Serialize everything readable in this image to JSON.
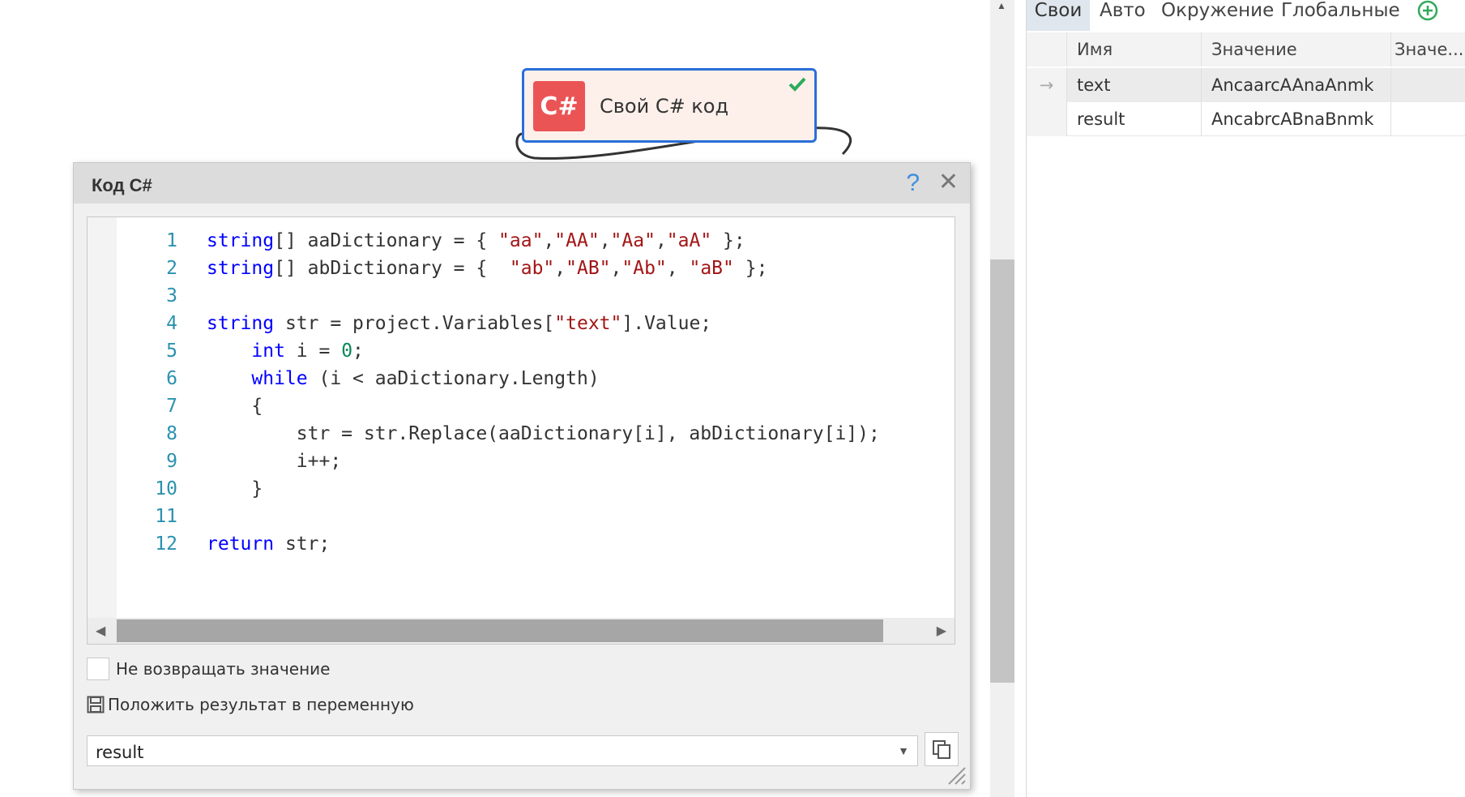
{
  "node": {
    "icon_text": "C#",
    "title": "Свой C# код",
    "status_icon": "check-icon"
  },
  "dialog": {
    "title": "Код C#",
    "help_label": "?",
    "close_label": "✕",
    "code_lines": [
      {
        "n": "1",
        "tokens": [
          [
            "kw",
            "string"
          ],
          [
            "t",
            "[] aaDictionary = { "
          ],
          [
            "str",
            "\"aa\""
          ],
          [
            "t",
            ","
          ],
          [
            "str",
            "\"AA\""
          ],
          [
            "t",
            ","
          ],
          [
            "str",
            "\"Aa\""
          ],
          [
            "t",
            ","
          ],
          [
            "str",
            "\"aA\""
          ],
          [
            "t",
            " };"
          ]
        ]
      },
      {
        "n": "2",
        "tokens": [
          [
            "kw",
            "string"
          ],
          [
            "t",
            "[] abDictionary = {  "
          ],
          [
            "str",
            "\"ab\""
          ],
          [
            "t",
            ","
          ],
          [
            "str",
            "\"AB\""
          ],
          [
            "t",
            ","
          ],
          [
            "str",
            "\"Ab\""
          ],
          [
            "t",
            ", "
          ],
          [
            "str",
            "\"aB\""
          ],
          [
            "t",
            " };"
          ]
        ]
      },
      {
        "n": "3",
        "tokens": []
      },
      {
        "n": "4",
        "tokens": [
          [
            "kw",
            "string"
          ],
          [
            "t",
            " str = project.Variables["
          ],
          [
            "str",
            "\"text\""
          ],
          [
            "t",
            "].Value;"
          ]
        ]
      },
      {
        "n": "5",
        "tokens": [
          [
            "t",
            "    "
          ],
          [
            "kw",
            "int"
          ],
          [
            "t",
            " i = "
          ],
          [
            "num",
            "0"
          ],
          [
            "t",
            ";"
          ]
        ]
      },
      {
        "n": "6",
        "tokens": [
          [
            "t",
            "    "
          ],
          [
            "kw",
            "while"
          ],
          [
            "t",
            " (i < aaDictionary.Length)"
          ]
        ]
      },
      {
        "n": "7",
        "tokens": [
          [
            "t",
            "    {"
          ]
        ]
      },
      {
        "n": "8",
        "tokens": [
          [
            "t",
            "        str = str.Replace(aaDictionary[i], abDictionary[i]);"
          ]
        ]
      },
      {
        "n": "9",
        "tokens": [
          [
            "t",
            "        i++;"
          ]
        ]
      },
      {
        "n": "10",
        "tokens": [
          [
            "t",
            "    }"
          ]
        ]
      },
      {
        "n": "11",
        "tokens": []
      },
      {
        "n": "12",
        "tokens": [
          [
            "kw",
            "return"
          ],
          [
            "t",
            " str;"
          ]
        ]
      }
    ],
    "option_noreturn_label": "Не возвращать значение",
    "option_noreturn_checked": false,
    "option_save_label": "Положить результат в переменную",
    "variable_value": "result"
  },
  "vars_panel": {
    "tabs": [
      "Свои",
      "Авто",
      "Окружение",
      "Глобальные"
    ],
    "active_tab": "Свои",
    "columns": [
      "Имя",
      "Значение",
      "Значе..."
    ],
    "rows": [
      {
        "name": "text",
        "value": "AncaarcAAnaAnmk",
        "value2": "",
        "selected": true
      },
      {
        "name": "result",
        "value": "AncabrcABnaBnmk",
        "value2": "",
        "selected": false
      }
    ]
  }
}
